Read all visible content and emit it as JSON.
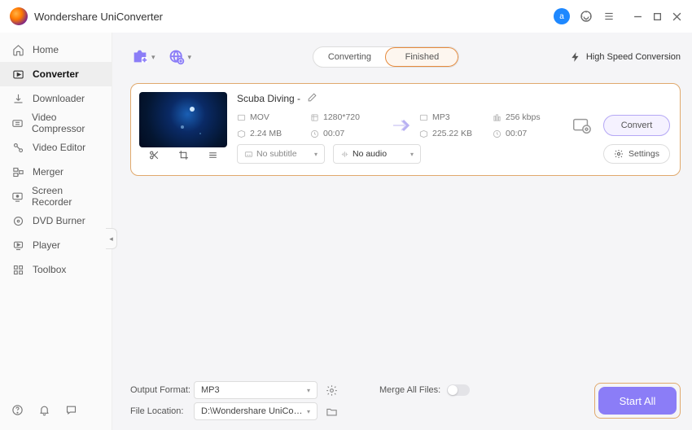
{
  "app": {
    "title": "Wondershare UniConverter"
  },
  "titlebar": {
    "user_initial": "a"
  },
  "sidebar": {
    "items": [
      {
        "label": "Home",
        "icon": "home-icon"
      },
      {
        "label": "Converter",
        "icon": "converter-icon"
      },
      {
        "label": "Downloader",
        "icon": "downloader-icon"
      },
      {
        "label": "Video Compressor",
        "icon": "compressor-icon"
      },
      {
        "label": "Video Editor",
        "icon": "editor-icon"
      },
      {
        "label": "Merger",
        "icon": "merger-icon"
      },
      {
        "label": "Screen Recorder",
        "icon": "recorder-icon"
      },
      {
        "label": "DVD Burner",
        "icon": "burner-icon"
      },
      {
        "label": "Player",
        "icon": "player-icon"
      },
      {
        "label": "Toolbox",
        "icon": "toolbox-icon"
      }
    ]
  },
  "toolbar": {
    "tabs": {
      "converting": "Converting",
      "finished": "Finished"
    },
    "high_speed": "High Speed Conversion"
  },
  "file": {
    "name": "Scuba Diving -",
    "src": {
      "fmt": "MOV",
      "res": "1280*720",
      "size": "2.24 MB",
      "dur": "00:07"
    },
    "dst": {
      "fmt": "MP3",
      "bitrate": "256 kbps",
      "size": "225.22 KB",
      "dur": "00:07"
    },
    "subtitle": "No subtitle",
    "audio": "No audio",
    "settings_btn": "Settings",
    "convert_btn": "Convert"
  },
  "footer": {
    "output_format_label": "Output Format:",
    "output_format_value": "MP3",
    "file_location_label": "File Location:",
    "file_location_value": "D:\\Wondershare UniConverter",
    "merge_label": "Merge All Files:",
    "start_all": "Start All"
  }
}
